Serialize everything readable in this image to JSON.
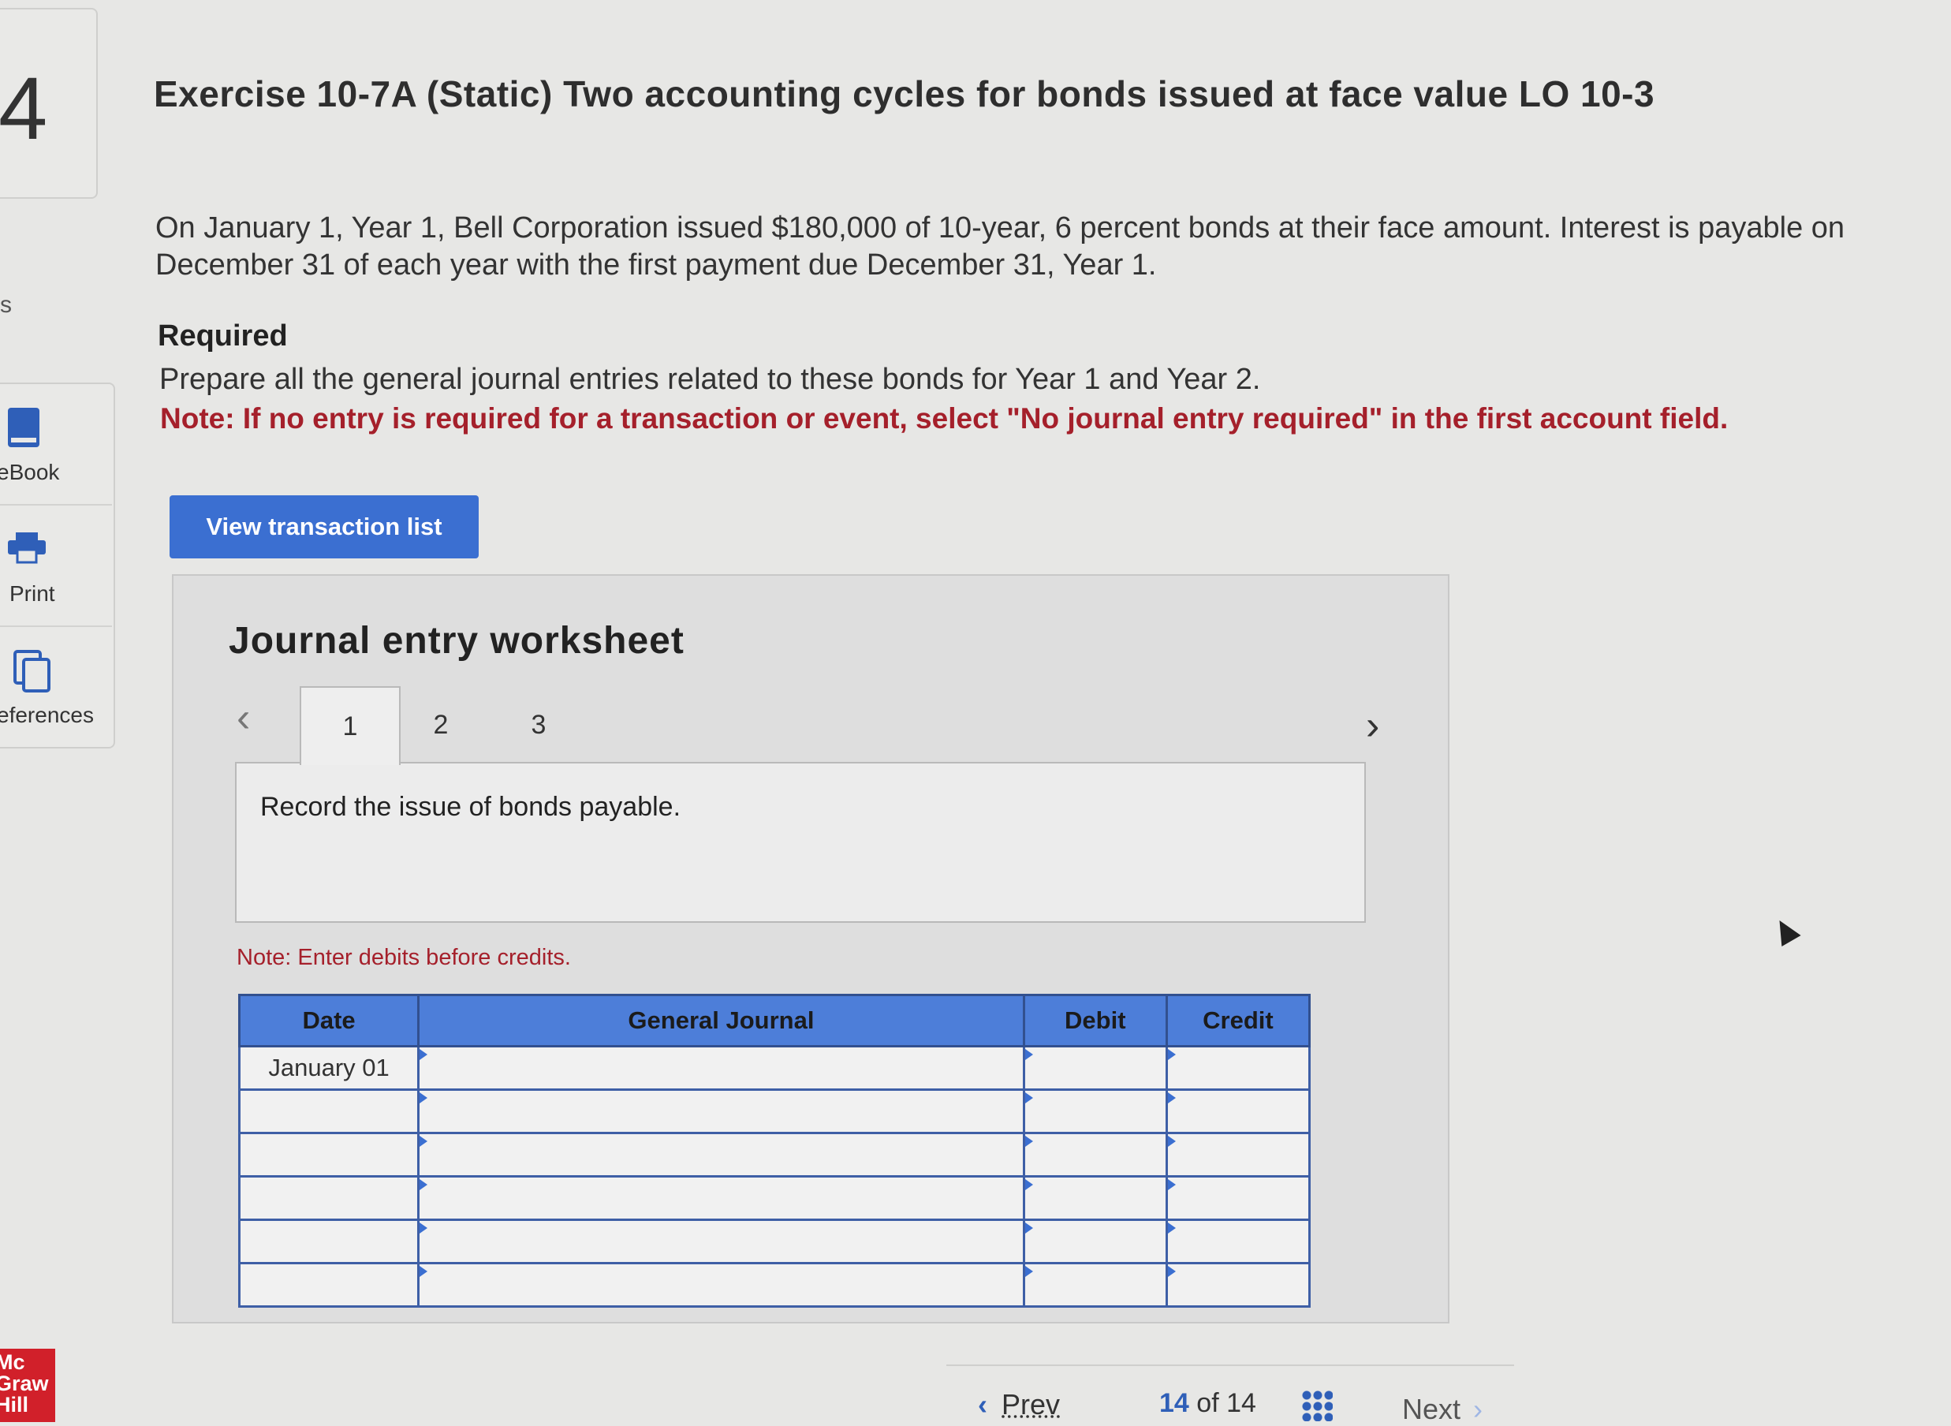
{
  "question": {
    "number": "4"
  },
  "sidebar": {
    "partial_label": "s",
    "items": [
      {
        "label": "eBook",
        "icon": "ebook-icon"
      },
      {
        "label": "Print",
        "icon": "print-icon"
      },
      {
        "label": "eferences",
        "icon": "references-icon"
      }
    ]
  },
  "branding": {
    "logo_lines": [
      "Mc",
      "Graw",
      "Hill"
    ]
  },
  "exercise": {
    "title": "Exercise 10-7A (Static) Two accounting cycles for bonds issued at face value LO 10-3",
    "intro": "On January 1, Year 1, Bell Corporation issued $180,000 of 10-year, 6 percent bonds at their face amount. Interest is payable on December 31 of each year with the first payment due December 31, Year 1.",
    "required_heading": "Required",
    "required_text": "Prepare all the general journal entries related to these bonds for Year 1 and Year 2.",
    "note": "Note: If no entry is required for a transaction or event, select \"No journal entry required\" in the first account field."
  },
  "buttons": {
    "view_transactions": "View transaction list"
  },
  "worksheet": {
    "title": "Journal entry worksheet",
    "tabs": [
      "1",
      "2",
      "3"
    ],
    "active_tab": "1",
    "prev_icon": "chevron-left-icon",
    "next_icon": "chevron-right-icon",
    "description": "Record the issue of bonds payable.",
    "note": "Note: Enter debits before credits.",
    "table": {
      "headers": [
        "Date",
        "General Journal",
        "Debit",
        "Credit"
      ],
      "rows": [
        {
          "date": "January 01",
          "account": "",
          "debit": "",
          "credit": ""
        },
        {
          "date": "",
          "account": "",
          "debit": "",
          "credit": ""
        },
        {
          "date": "",
          "account": "",
          "debit": "",
          "credit": ""
        },
        {
          "date": "",
          "account": "",
          "debit": "",
          "credit": ""
        },
        {
          "date": "",
          "account": "",
          "debit": "",
          "credit": ""
        },
        {
          "date": "",
          "account": "",
          "debit": "",
          "credit": ""
        }
      ]
    }
  },
  "pagination": {
    "prev_label": "Prev",
    "current": "14",
    "of_label": "of",
    "total": "14",
    "next_label": "Next"
  },
  "colors": {
    "accent": "#3b6fd1",
    "note_red": "#a5202b",
    "table_header": "#4d7ed9",
    "logo": "#d1202a"
  }
}
